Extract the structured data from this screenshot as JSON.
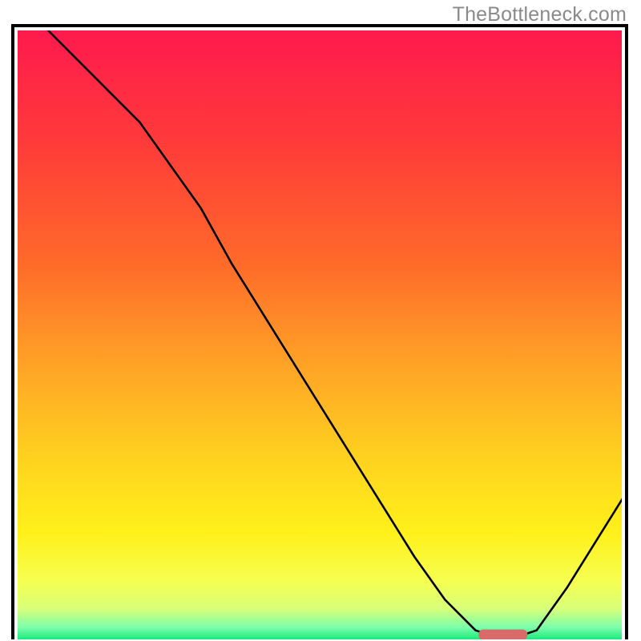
{
  "watermark": "TheBottleneck.com",
  "chart_data": {
    "type": "line",
    "title": "",
    "xlabel": "",
    "ylabel": "",
    "xlim": [
      0,
      100
    ],
    "ylim": [
      0,
      100
    ],
    "grid": false,
    "legend": false,
    "series": [
      {
        "name": "bottleneck-curve",
        "x": [
          5,
          10,
          15,
          20,
          25,
          30,
          35,
          40,
          45,
          50,
          55,
          60,
          65,
          70,
          75,
          78,
          82,
          85,
          90,
          95,
          100
        ],
        "y": [
          100,
          95,
          90,
          85,
          78,
          71,
          62,
          54,
          46,
          38,
          30,
          22,
          14,
          7,
          2,
          1,
          1,
          2,
          9,
          17,
          25
        ]
      }
    ],
    "annotations": [
      {
        "name": "optimal-marker",
        "shape": "rounded-rect",
        "x_range": [
          75.5,
          83.5
        ],
        "y": 1.3,
        "color": "#d86a6a"
      }
    ],
    "background_gradient": {
      "stops": [
        {
          "offset": 0.0,
          "color": "#ff1a4d"
        },
        {
          "offset": 0.18,
          "color": "#ff3a3a"
        },
        {
          "offset": 0.38,
          "color": "#ff6a2a"
        },
        {
          "offset": 0.55,
          "color": "#ffa426"
        },
        {
          "offset": 0.7,
          "color": "#ffd21f"
        },
        {
          "offset": 0.82,
          "color": "#fff01a"
        },
        {
          "offset": 0.9,
          "color": "#f6ff50"
        },
        {
          "offset": 0.945,
          "color": "#d8ff7a"
        },
        {
          "offset": 0.975,
          "color": "#7dffab"
        },
        {
          "offset": 1.0,
          "color": "#00e36e"
        }
      ]
    }
  }
}
